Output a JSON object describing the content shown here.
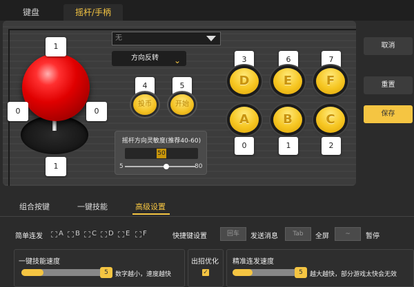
{
  "tabs": {
    "keyboard": "键盘",
    "joystick": "摇杆/手柄"
  },
  "joystick": {
    "up": "1",
    "left": "0",
    "right": "0",
    "down": "1"
  },
  "direction_select": {
    "value": "无"
  },
  "reverse_label": "方向反转",
  "small_buttons": {
    "coin": {
      "label": "投币",
      "key": "4"
    },
    "start": {
      "label": "开始",
      "key": "5"
    }
  },
  "sensitivity": {
    "title": "摇杆方向灵敏度(推荐40-60)",
    "value": "50",
    "min": "5",
    "max": "80"
  },
  "action_buttons": [
    {
      "label": "D",
      "key": "3"
    },
    {
      "label": "E",
      "key": "6"
    },
    {
      "label": "F",
      "key": "7"
    },
    {
      "label": "A",
      "key": "0"
    },
    {
      "label": "B",
      "key": "1"
    },
    {
      "label": "C",
      "key": "2"
    }
  ],
  "side": {
    "cancel": "取消",
    "reset": "重置",
    "save": "保存"
  },
  "bottom_tabs": [
    "组合按键",
    "一键技能",
    "高级设置"
  ],
  "auto_fire": {
    "label": "简单连发",
    "options": [
      "A",
      "B",
      "C",
      "D",
      "E",
      "F"
    ]
  },
  "hotkeys": {
    "label": "快捷键设置",
    "items": [
      {
        "key": "回车",
        "action": "发送消息"
      },
      {
        "key": "Tab",
        "action": "全屏"
      },
      {
        "key": "~",
        "action": "暂停"
      }
    ]
  },
  "skill_speed": {
    "title": "一键技能速度",
    "value": "5",
    "hint": "数字越小，速度越快",
    "level": 0.2
  },
  "move_opt": {
    "title": "出招优化",
    "checked": "✓"
  },
  "precise_speed": {
    "title": "精准连发速度",
    "value": "5",
    "hint": "越大越快，部分游戏太快会无效",
    "level": 0.2
  },
  "colors": {
    "accent": "#f5c542",
    "bg": "#2b2b2b"
  }
}
